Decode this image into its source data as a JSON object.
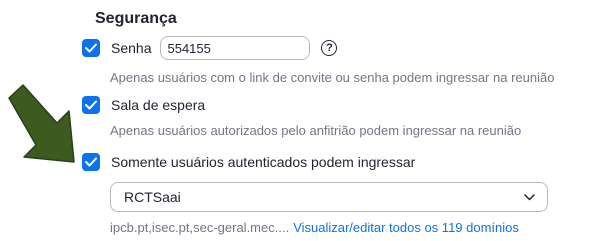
{
  "section": {
    "title": "Segurança"
  },
  "password": {
    "label": "Senha",
    "value": "554155",
    "checked": true,
    "help_glyph": "?",
    "description": "Apenas usuários com o link de convite ou senha podem ingressar na reunião"
  },
  "waiting_room": {
    "label": "Sala de espera",
    "checked": true,
    "description": "Apenas usuários autorizados pelo anfitrião podem ingressar na reunião"
  },
  "authenticated": {
    "label": "Somente usuários autenticados podem ingressar",
    "checked": true,
    "selected_option": "RCTSaai",
    "domains_text": "ipcb.pt,isec.pt,sec-geral.mec....",
    "domains_link": "Visualizar/editar todos os 119 domínios"
  },
  "colors": {
    "accent": "#0e72ed",
    "arrow": "#3d5a1f",
    "text": "#232333",
    "muted": "#747487"
  },
  "icons": {
    "checkbox": "checkmark-icon",
    "help": "question-circle-icon",
    "dropdown": "chevron-down-icon",
    "annotation": "arrow-icon"
  }
}
